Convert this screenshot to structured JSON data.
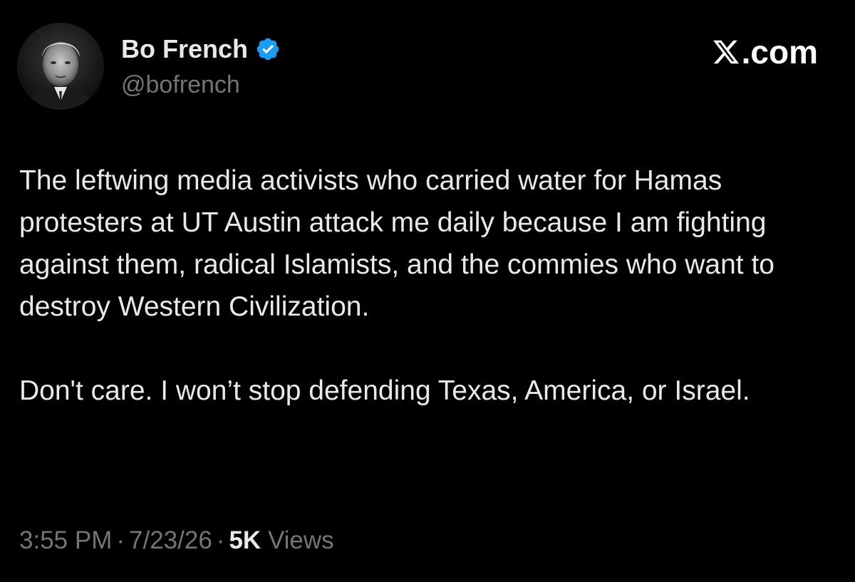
{
  "author": {
    "display_name": "Bo French",
    "handle": "@bofrench",
    "verified": true,
    "verified_icon": "verified-badge-icon",
    "verified_color": "#1d9bf0",
    "avatar_icon": "profile-photo"
  },
  "brand": {
    "icon": "x-logo-icon",
    "text": ".com"
  },
  "post": {
    "paragraphs": [
      "The leftwing media activists who carried water for Hamas protesters at UT Austin attack me daily because I am fighting against them, radical Islamists, and the commies who want to destroy Western Civilization.",
      "Don't care. I won’t stop defending Texas, America, or Israel."
    ]
  },
  "meta": {
    "time": "3:55 PM",
    "separator": "·",
    "date": "7/23/26",
    "views_count": "5K",
    "views_label": "Views"
  },
  "colors": {
    "background": "#000000",
    "primary_text": "#e7e9ea",
    "secondary_text": "#71767b"
  }
}
